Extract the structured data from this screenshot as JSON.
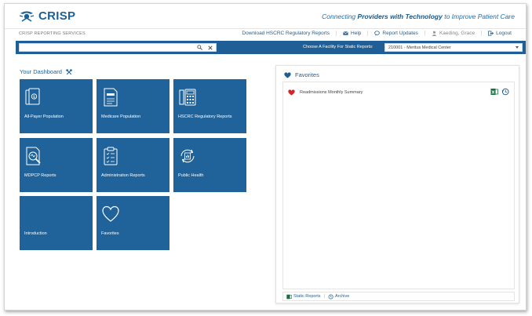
{
  "header": {
    "logo_text": "CRISP",
    "tagline_prefix": "Connecting ",
    "tagline_bold": "Providers with Technology",
    "tagline_suffix": " to Improve Patient Care"
  },
  "subnav": {
    "service_name": "CRISP REPORTING SERVICES",
    "download_link": "Download HSCRC Regulatory Reports",
    "help_link": "Help",
    "report_updates_link": "Report Updates",
    "user_name": "Kaeding, Grace",
    "logout_link": "Logout"
  },
  "toolbar": {
    "search_value": "",
    "facility_label": "Choose A Facility For Static Reports:",
    "facility_selected": "210001 - Meritus Medical Center"
  },
  "dashboard": {
    "title": "Your Dashboard",
    "tiles": [
      {
        "label": "All-Payer Population",
        "icon": "dollar-bills-icon"
      },
      {
        "label": "Medicare Population",
        "icon": "medicare-card-icon"
      },
      {
        "label": "HSCRC Regulatory Reports",
        "icon": "calculator-icon"
      },
      {
        "label": "MDPCP Reports",
        "icon": "magnifier-document-icon"
      },
      {
        "label": "Administration Reports",
        "icon": "clipboard-icon"
      },
      {
        "label": "Public Health",
        "icon": "refresh-chart-icon"
      },
      {
        "label": "Introduction",
        "icon": ""
      },
      {
        "label": "Favorites",
        "icon": "heart-outline-icon"
      }
    ]
  },
  "favorites": {
    "title": "Favorites",
    "items": [
      {
        "label": "Readmissions Monthly Summary"
      }
    ],
    "footer_static": "Static Reports",
    "footer_separator": "|",
    "footer_archive": "Archive"
  },
  "colors": {
    "brand_blue": "#1f639a",
    "bar_blue": "#1f5f95",
    "heart_red": "#d0262b"
  }
}
